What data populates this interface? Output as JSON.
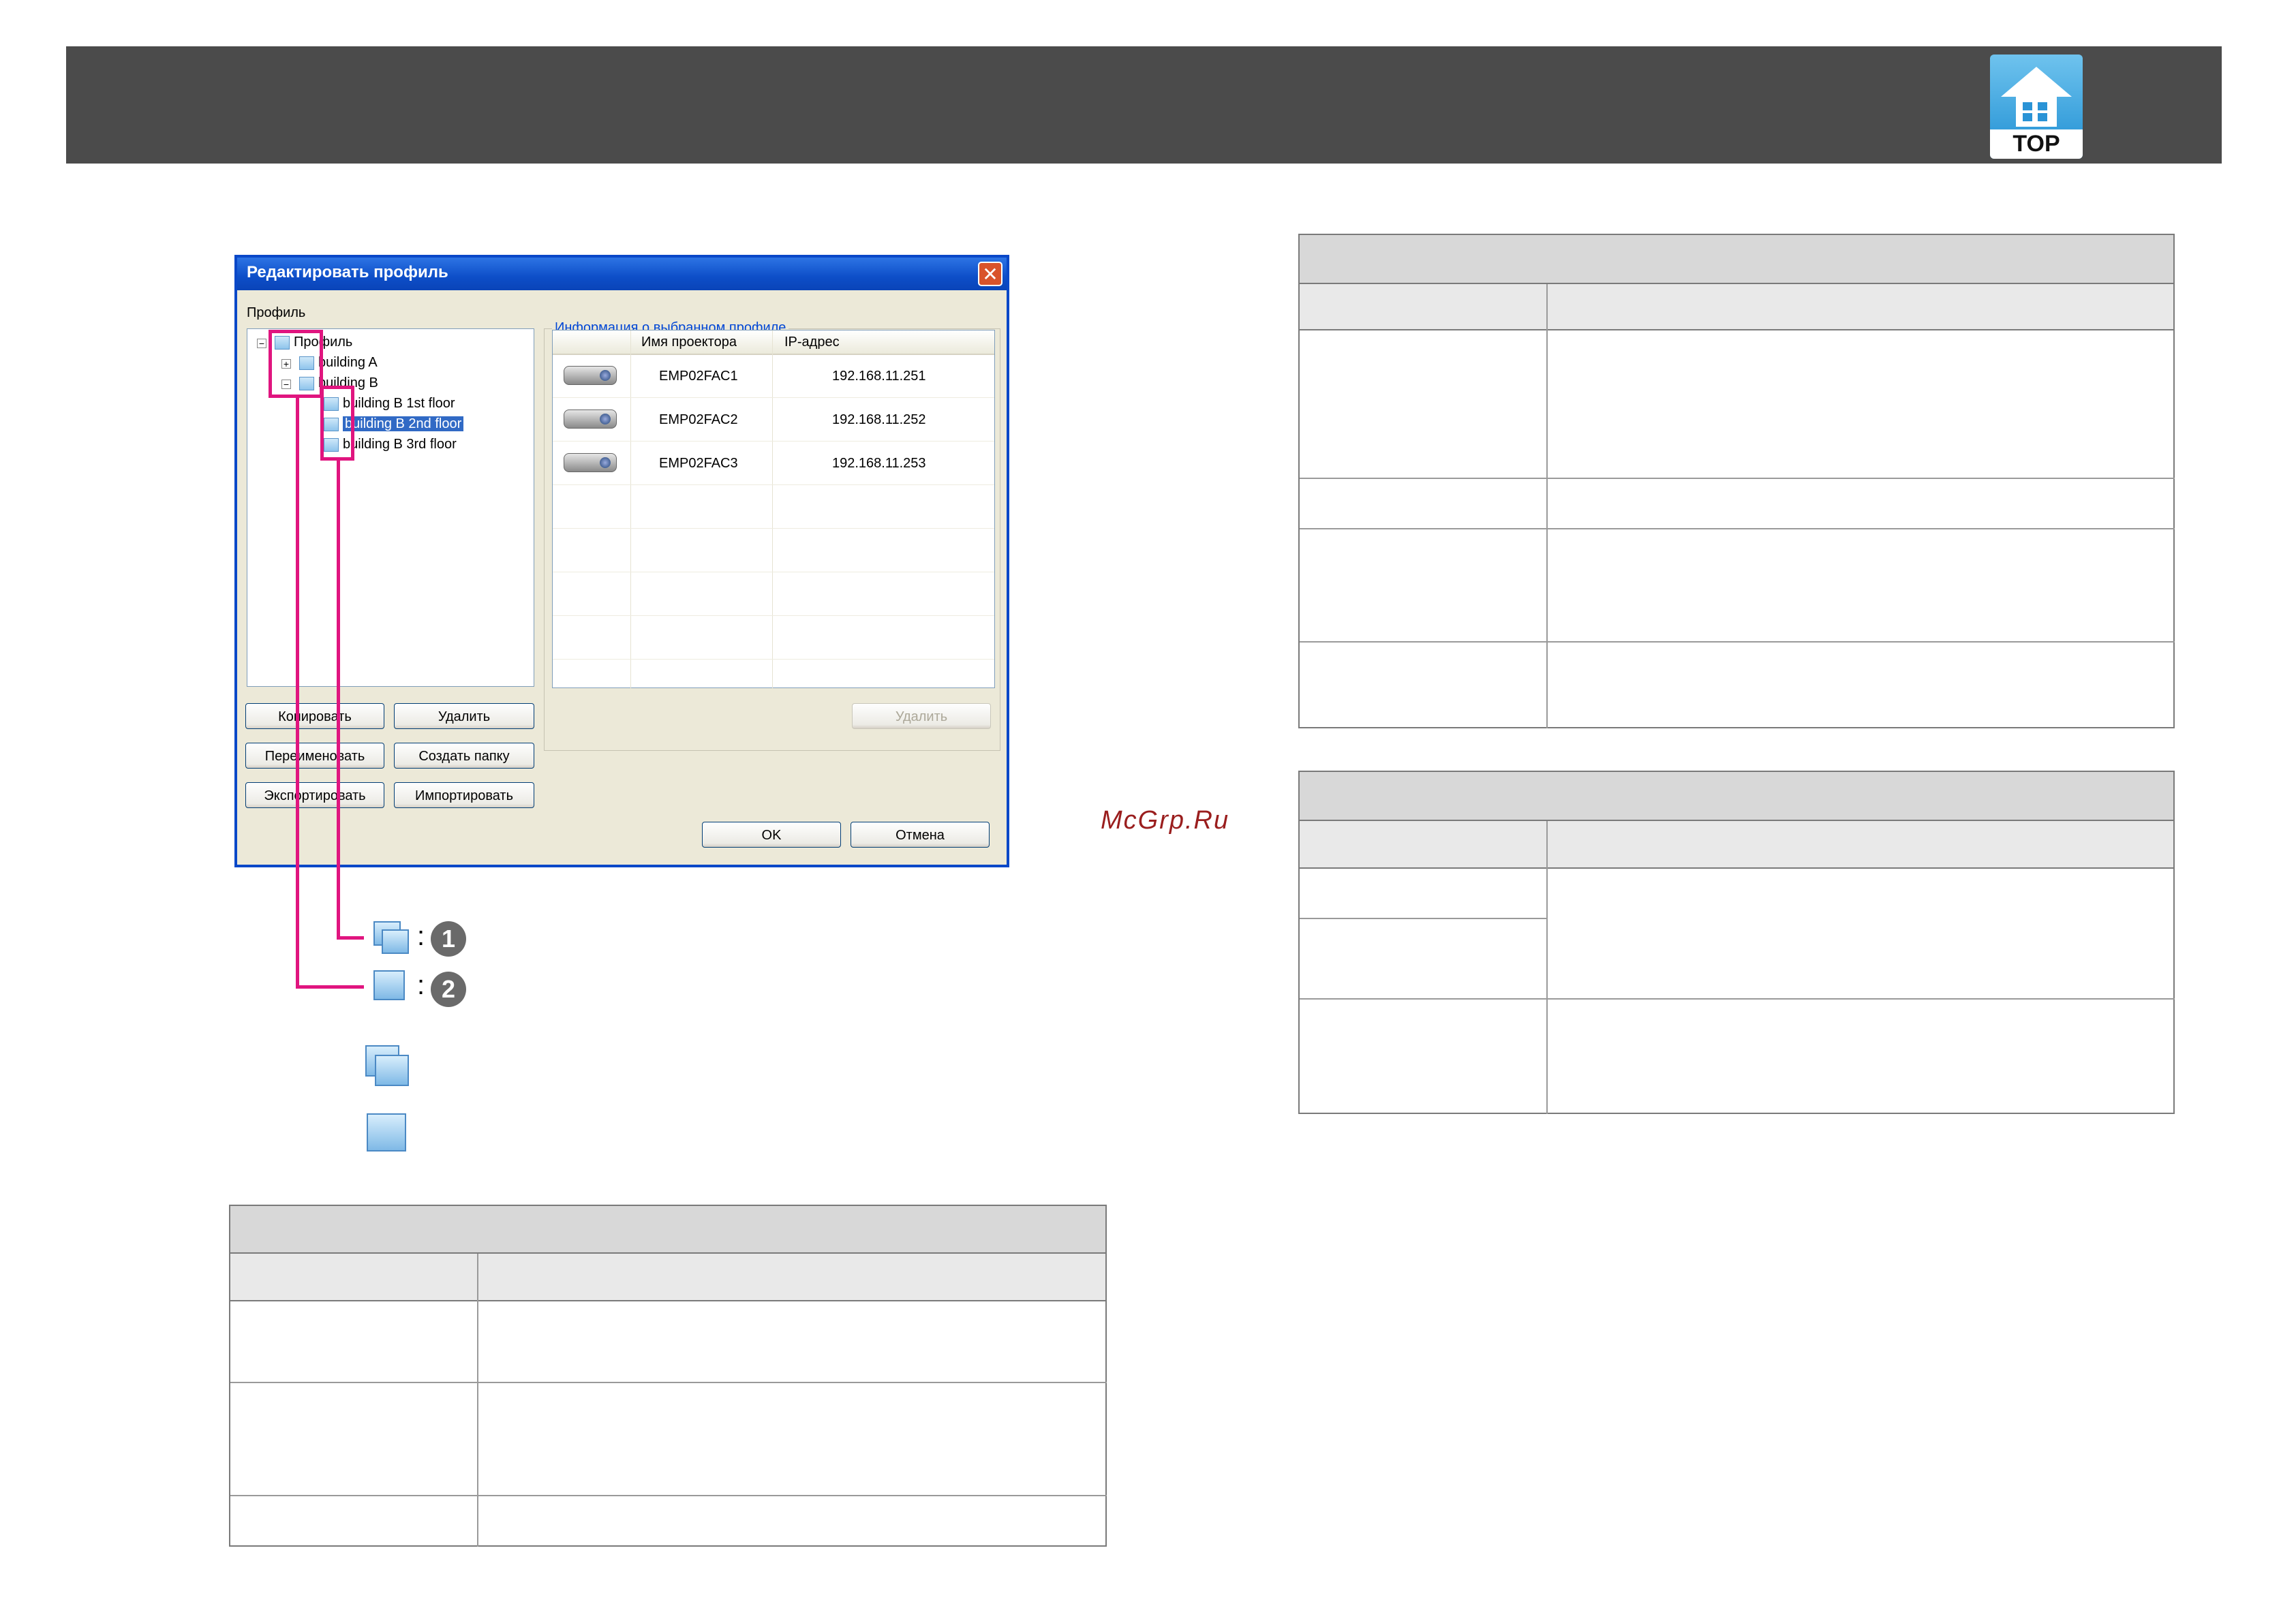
{
  "header": {
    "logo_label": "TOP",
    "logo_icon": "home-icon"
  },
  "dialog": {
    "title": "Редактировать профиль",
    "close_icon": "close-icon",
    "profile_label": "Профиль",
    "tree": {
      "root": "Профиль",
      "nodes": [
        {
          "label": "building A",
          "expander": "+"
        },
        {
          "label": "building B",
          "expander": "−"
        },
        {
          "label": "building B 1st floor"
        },
        {
          "label": "building B 2nd floor",
          "selected": true
        },
        {
          "label": "building B 3rd floor"
        }
      ]
    },
    "info_label": "Информация о выбранном профиле",
    "table": {
      "columns": [
        "Имя проектора",
        "IP-адрес"
      ],
      "rows": [
        {
          "name": "EMP02FAC1",
          "ip": "192.168.11.251"
        },
        {
          "name": "EMP02FAC2",
          "ip": "192.168.11.252"
        },
        {
          "name": "EMP02FAC3",
          "ip": "192.168.11.253"
        }
      ]
    },
    "buttons": {
      "copy": "Копировать",
      "delete": "Удалить",
      "rename": "Переименовать",
      "create_folder": "Создать папку",
      "export": "Экспортировать",
      "import": "Импортировать",
      "info_delete": "Удалить",
      "ok": "OK",
      "cancel": "Отмена"
    }
  },
  "legend": {
    "colon": ":",
    "items": [
      {
        "icon": "folder-stack-icon",
        "number": "1"
      },
      {
        "icon": "folder-icon",
        "number": "2"
      }
    ]
  },
  "watermark": "McGrp.Ru"
}
